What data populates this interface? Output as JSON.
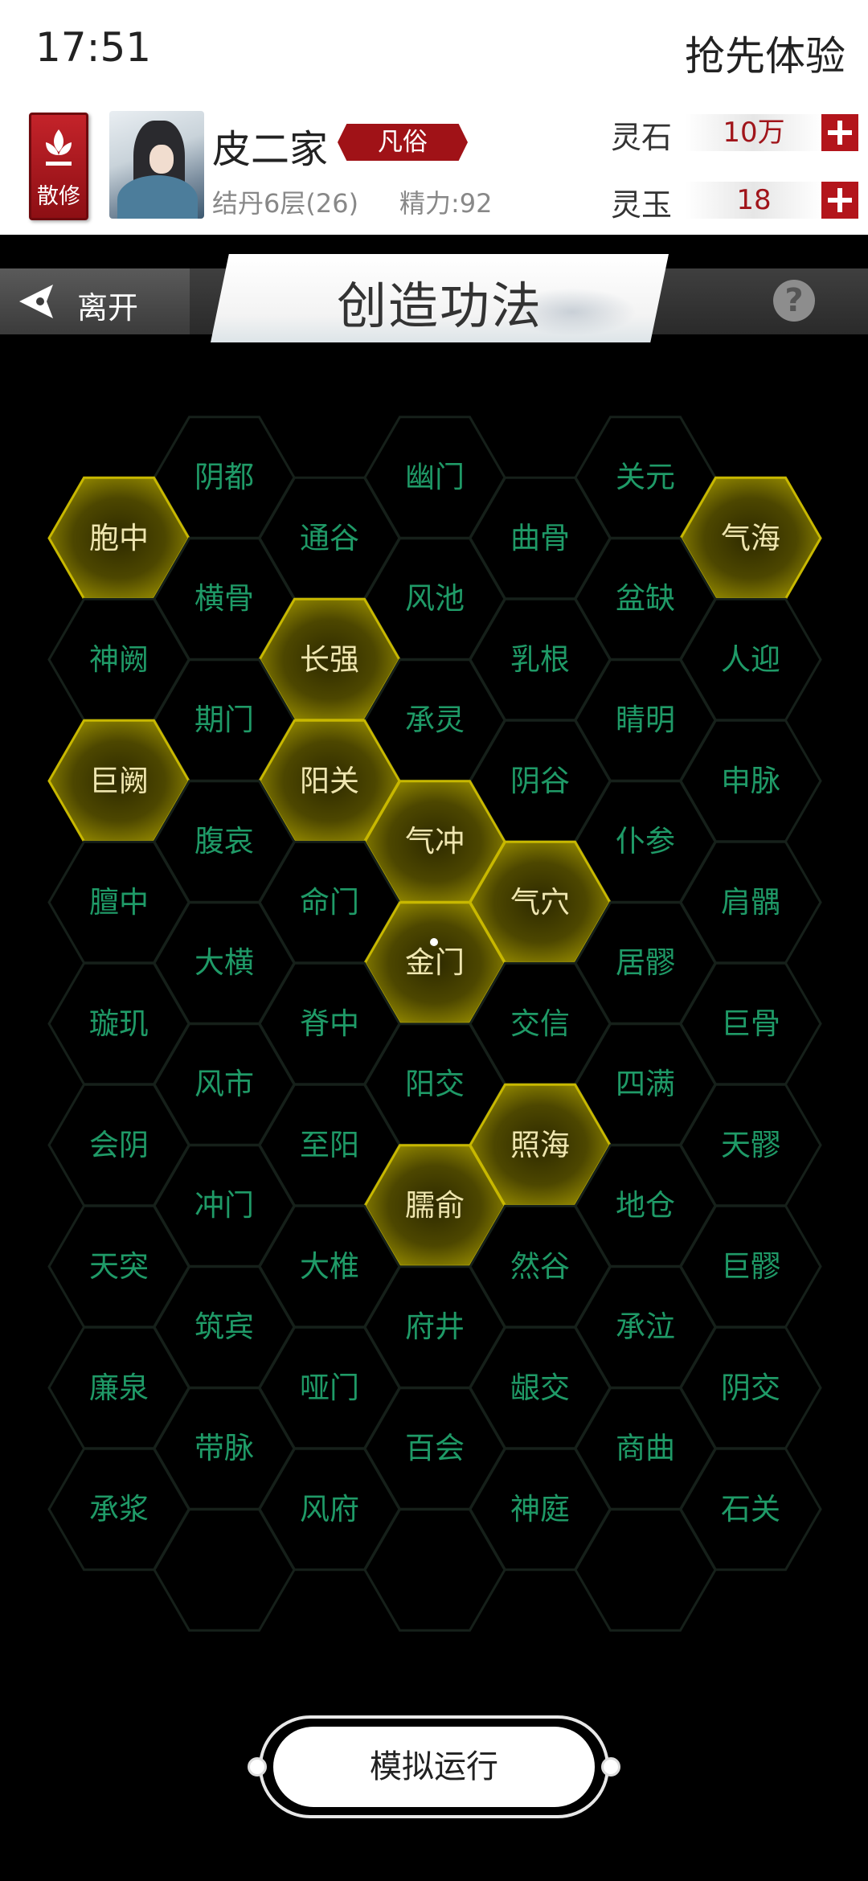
{
  "status": {
    "time": "17:51",
    "trial": "抢先体验"
  },
  "player": {
    "sect_badge": "散修",
    "name": "皮二家",
    "rank": "凡俗",
    "realm": "结丹6层(26)",
    "energy": "精力:92"
  },
  "resources": [
    {
      "label": "灵石",
      "value": "10万"
    },
    {
      "label": "灵玉",
      "value": "18"
    }
  ],
  "header": {
    "back_label": "离开",
    "title": "创造功法",
    "help": "?"
  },
  "hexes": [
    {
      "name": "阴都",
      "col": 1,
      "row": 0,
      "on": false
    },
    {
      "name": "幽门",
      "col": 3,
      "row": 0,
      "on": false
    },
    {
      "name": "关元",
      "col": 5,
      "row": 0,
      "on": false
    },
    {
      "name": "胞中",
      "col": 0,
      "row": 1,
      "on": true
    },
    {
      "name": "通谷",
      "col": 2,
      "row": 1,
      "on": false
    },
    {
      "name": "曲骨",
      "col": 4,
      "row": 1,
      "on": false
    },
    {
      "name": "气海",
      "col": 6,
      "row": 1,
      "on": true
    },
    {
      "name": "横骨",
      "col": 1,
      "row": 2,
      "on": false
    },
    {
      "name": "风池",
      "col": 3,
      "row": 2,
      "on": false
    },
    {
      "name": "盆缺",
      "col": 5,
      "row": 2,
      "on": false
    },
    {
      "name": "神阙",
      "col": 0,
      "row": 3,
      "on": false
    },
    {
      "name": "长强",
      "col": 2,
      "row": 3,
      "on": true
    },
    {
      "name": "乳根",
      "col": 4,
      "row": 3,
      "on": false
    },
    {
      "name": "人迎",
      "col": 6,
      "row": 3,
      "on": false
    },
    {
      "name": "期门",
      "col": 1,
      "row": 4,
      "on": false
    },
    {
      "name": "承灵",
      "col": 3,
      "row": 4,
      "on": false
    },
    {
      "name": "睛明",
      "col": 5,
      "row": 4,
      "on": false
    },
    {
      "name": "巨阙",
      "col": 0,
      "row": 5,
      "on": true
    },
    {
      "name": "阳关",
      "col": 2,
      "row": 5,
      "on": true
    },
    {
      "name": "阴谷",
      "col": 4,
      "row": 5,
      "on": false
    },
    {
      "name": "申脉",
      "col": 6,
      "row": 5,
      "on": false
    },
    {
      "name": "腹哀",
      "col": 1,
      "row": 6,
      "on": false
    },
    {
      "name": "气冲",
      "col": 3,
      "row": 6,
      "on": true
    },
    {
      "name": "仆参",
      "col": 5,
      "row": 6,
      "on": false
    },
    {
      "name": "膻中",
      "col": 0,
      "row": 7,
      "on": false
    },
    {
      "name": "命门",
      "col": 2,
      "row": 7,
      "on": false
    },
    {
      "name": "气穴",
      "col": 4,
      "row": 7,
      "on": true
    },
    {
      "name": "肩髃",
      "col": 6,
      "row": 7,
      "on": false
    },
    {
      "name": "大横",
      "col": 1,
      "row": 8,
      "on": false
    },
    {
      "name": "金门",
      "col": 3,
      "row": 8,
      "on": true
    },
    {
      "name": "居髎",
      "col": 5,
      "row": 8,
      "on": false
    },
    {
      "name": "璇玑",
      "col": 0,
      "row": 9,
      "on": false
    },
    {
      "name": "脊中",
      "col": 2,
      "row": 9,
      "on": false
    },
    {
      "name": "交信",
      "col": 4,
      "row": 9,
      "on": false
    },
    {
      "name": "巨骨",
      "col": 6,
      "row": 9,
      "on": false
    },
    {
      "name": "风市",
      "col": 1,
      "row": 10,
      "on": false
    },
    {
      "name": "阳交",
      "col": 3,
      "row": 10,
      "on": false
    },
    {
      "name": "四满",
      "col": 5,
      "row": 10,
      "on": false
    },
    {
      "name": "会阴",
      "col": 0,
      "row": 11,
      "on": false
    },
    {
      "name": "至阳",
      "col": 2,
      "row": 11,
      "on": false
    },
    {
      "name": "照海",
      "col": 4,
      "row": 11,
      "on": true
    },
    {
      "name": "天髎",
      "col": 6,
      "row": 11,
      "on": false
    },
    {
      "name": "冲门",
      "col": 1,
      "row": 12,
      "on": false
    },
    {
      "name": "臑俞",
      "col": 3,
      "row": 12,
      "on": true
    },
    {
      "name": "地仓",
      "col": 5,
      "row": 12,
      "on": false
    },
    {
      "name": "天突",
      "col": 0,
      "row": 13,
      "on": false
    },
    {
      "name": "大椎",
      "col": 2,
      "row": 13,
      "on": false
    },
    {
      "name": "然谷",
      "col": 4,
      "row": 13,
      "on": false
    },
    {
      "name": "巨髎",
      "col": 6,
      "row": 13,
      "on": false
    },
    {
      "name": "筑宾",
      "col": 1,
      "row": 14,
      "on": false
    },
    {
      "name": "府井",
      "col": 3,
      "row": 14,
      "on": false
    },
    {
      "name": "承泣",
      "col": 5,
      "row": 14,
      "on": false
    },
    {
      "name": "廉泉",
      "col": 0,
      "row": 15,
      "on": false
    },
    {
      "name": "哑门",
      "col": 2,
      "row": 15,
      "on": false
    },
    {
      "name": "龈交",
      "col": 4,
      "row": 15,
      "on": false
    },
    {
      "name": "阴交",
      "col": 6,
      "row": 15,
      "on": false
    },
    {
      "name": "带脉",
      "col": 1,
      "row": 16,
      "on": false
    },
    {
      "name": "百会",
      "col": 3,
      "row": 16,
      "on": false
    },
    {
      "name": "商曲",
      "col": 5,
      "row": 16,
      "on": false
    },
    {
      "name": "承浆",
      "col": 0,
      "row": 17,
      "on": false
    },
    {
      "name": "风府",
      "col": 2,
      "row": 17,
      "on": false
    },
    {
      "name": "神庭",
      "col": 4,
      "row": 17,
      "on": false
    },
    {
      "name": "石关",
      "col": 6,
      "row": 17,
      "on": false
    },
    {
      "name": "",
      "col": 1,
      "row": 18,
      "on": false
    },
    {
      "name": "",
      "col": 3,
      "row": 18,
      "on": false
    },
    {
      "name": "",
      "col": 5,
      "row": 18,
      "on": false
    }
  ],
  "action": {
    "simulate_label": "模拟运行"
  },
  "colors": {
    "accent": "#b3151b",
    "hex_on": "#c8b800",
    "hex_text": "#1f9a67"
  }
}
